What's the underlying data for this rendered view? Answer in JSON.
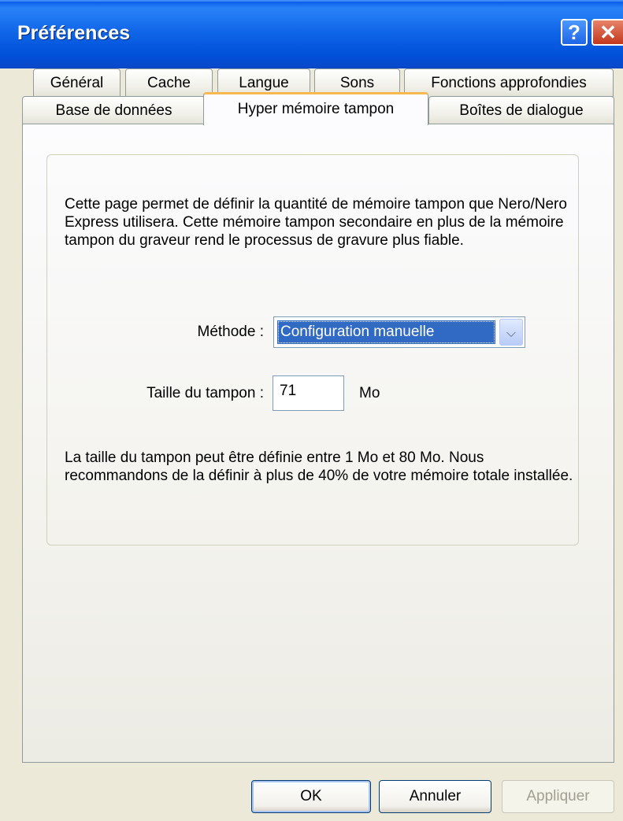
{
  "window": {
    "title": "Préférences",
    "help_label": "?",
    "close_label": "✕"
  },
  "tabs_row1": [
    "Général",
    "Cache",
    "Langue",
    "Sons",
    "Fonctions approfondies"
  ],
  "tabs_row2": [
    "Base de données",
    "Hyper mémoire tampon",
    "Boîtes de dialogue"
  ],
  "active_tab": "Hyper mémoire tampon",
  "panel": {
    "description": "Cette page permet de définir la quantité de mémoire tampon que Nero/Nero Express utilisera. Cette mémoire tampon secondaire en plus de la mémoire tampon du graveur rend le processus de gravure plus fiable.",
    "method_label": "Méthode :",
    "method_value": "Configuration manuelle",
    "buffer_label": "Taille du tampon :",
    "buffer_value": "71",
    "buffer_unit": "Mo",
    "note": "La taille du tampon peut être définie entre 1 Mo et 80 Mo. Nous recommandons de la définir à plus de 40% de votre mémoire totale installée."
  },
  "buttons": {
    "ok": "OK",
    "cancel": "Annuler",
    "apply": "Appliquer"
  },
  "colors": {
    "titlebar": "#0A5EE8",
    "selection": "#316AC5",
    "active_tab_accent": "#F8B850"
  }
}
